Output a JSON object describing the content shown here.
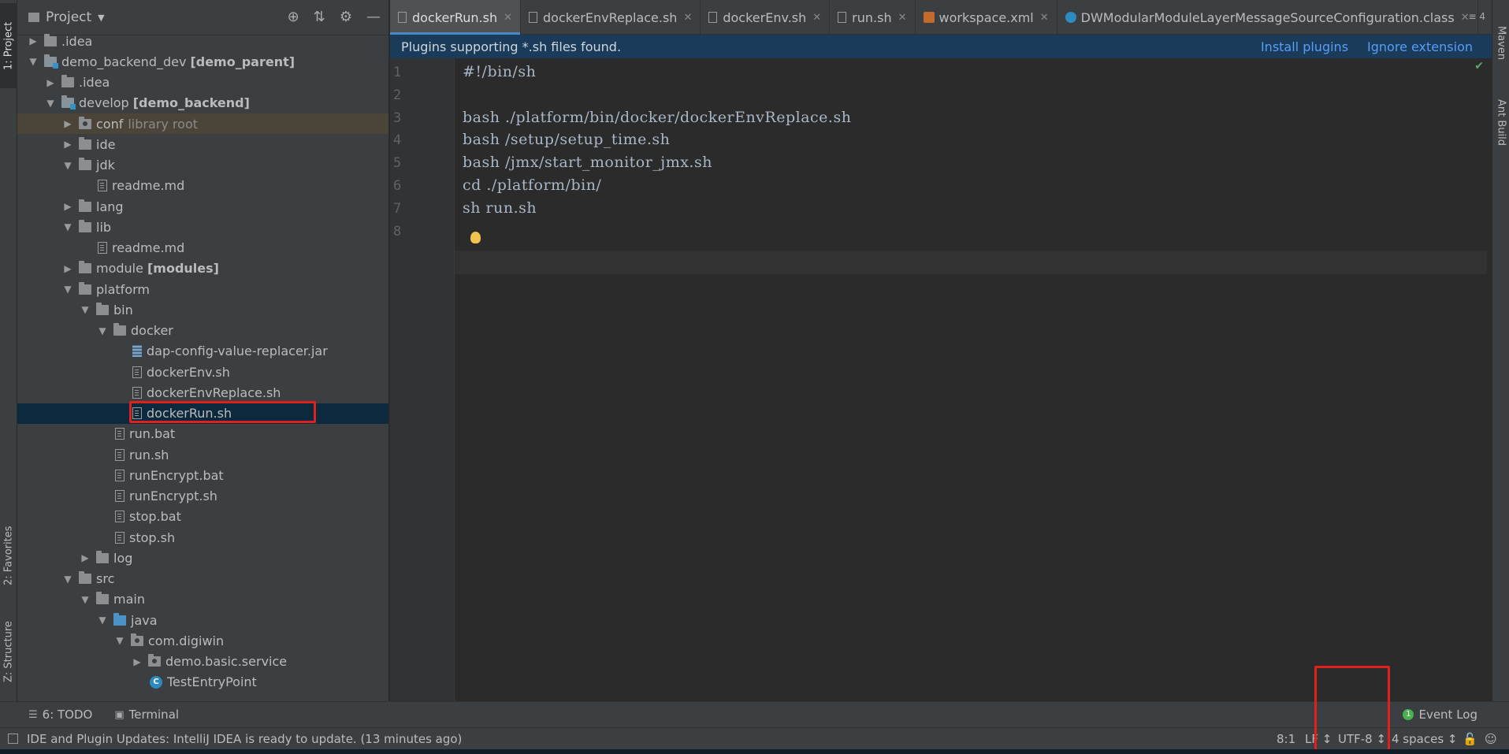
{
  "left_strip": {
    "project_tab": "1: Project",
    "favorites_tab": "2: Favorites",
    "structure_tab": "Z: Structure"
  },
  "right_strip": {
    "maven_tab": "Maven",
    "ant_tab": "Ant Build"
  },
  "project_panel": {
    "title": "Project",
    "tree": [
      {
        "indent": 0,
        "arrow": "right",
        "icon": "folder",
        "label": ".idea"
      },
      {
        "indent": 0,
        "arrow": "down",
        "icon": "module",
        "label": "demo_backend_dev",
        "bold": "[demo_parent]"
      },
      {
        "indent": 1,
        "arrow": "right",
        "icon": "folder",
        "label": ".idea"
      },
      {
        "indent": 1,
        "arrow": "down",
        "icon": "module",
        "label": "develop",
        "bold": "[demo_backend]"
      },
      {
        "indent": 2,
        "arrow": "right",
        "icon": "pkg",
        "label": "conf",
        "muted": "library root",
        "highlight": "conf"
      },
      {
        "indent": 2,
        "arrow": "right",
        "icon": "folder",
        "label": "ide"
      },
      {
        "indent": 2,
        "arrow": "down",
        "icon": "folder",
        "label": "jdk"
      },
      {
        "indent": 3,
        "arrow": "",
        "icon": "doc",
        "label": "readme.md"
      },
      {
        "indent": 2,
        "arrow": "right",
        "icon": "folder",
        "label": "lang"
      },
      {
        "indent": 2,
        "arrow": "down",
        "icon": "folder",
        "label": "lib"
      },
      {
        "indent": 3,
        "arrow": "",
        "icon": "doc",
        "label": "readme.md"
      },
      {
        "indent": 2,
        "arrow": "right",
        "icon": "folder",
        "label": "module",
        "bold": "[modules]"
      },
      {
        "indent": 2,
        "arrow": "down",
        "icon": "folder",
        "label": "platform"
      },
      {
        "indent": 3,
        "arrow": "down",
        "icon": "folder",
        "label": "bin"
      },
      {
        "indent": 4,
        "arrow": "down",
        "icon": "folder",
        "label": "docker"
      },
      {
        "indent": 5,
        "arrow": "",
        "icon": "jar",
        "label": "dap-config-value-replacer.jar"
      },
      {
        "indent": 5,
        "arrow": "",
        "icon": "doc",
        "label": "dockerEnv.sh"
      },
      {
        "indent": 5,
        "arrow": "",
        "icon": "doc",
        "label": "dockerEnvReplace.sh"
      },
      {
        "indent": 5,
        "arrow": "",
        "icon": "doc",
        "label": "dockerRun.sh",
        "highlight": "selected"
      },
      {
        "indent": 4,
        "arrow": "",
        "icon": "doc",
        "label": "run.bat"
      },
      {
        "indent": 4,
        "arrow": "",
        "icon": "doc",
        "label": "run.sh"
      },
      {
        "indent": 4,
        "arrow": "",
        "icon": "doc",
        "label": "runEncrypt.bat"
      },
      {
        "indent": 4,
        "arrow": "",
        "icon": "doc",
        "label": "runEncrypt.sh"
      },
      {
        "indent": 4,
        "arrow": "",
        "icon": "doc",
        "label": "stop.bat"
      },
      {
        "indent": 4,
        "arrow": "",
        "icon": "doc",
        "label": "stop.sh"
      },
      {
        "indent": 3,
        "arrow": "right",
        "icon": "folder",
        "label": "log"
      },
      {
        "indent": 2,
        "arrow": "down",
        "icon": "folder",
        "label": "src"
      },
      {
        "indent": 3,
        "arrow": "down",
        "icon": "folder",
        "label": "main"
      },
      {
        "indent": 4,
        "arrow": "down",
        "icon": "java",
        "label": "java"
      },
      {
        "indent": 5,
        "arrow": "down",
        "icon": "pkg",
        "label": "com.digiwin"
      },
      {
        "indent": 6,
        "arrow": "right",
        "icon": "pkg",
        "label": "demo.basic.service"
      },
      {
        "indent": 6,
        "arrow": "",
        "icon": "class",
        "label": "TestEntryPoint"
      }
    ]
  },
  "tabs": [
    {
      "label": "dockerRun.sh",
      "icon": "doc",
      "active": true
    },
    {
      "label": "dockerEnvReplace.sh",
      "icon": "doc"
    },
    {
      "label": "dockerEnv.sh",
      "icon": "doc"
    },
    {
      "label": "run.sh",
      "icon": "doc"
    },
    {
      "label": "workspace.xml",
      "icon": "xml"
    },
    {
      "label": "DWModularModuleLayerMessageSourceConfiguration.class",
      "icon": "class"
    }
  ],
  "tabs_more": "≡ 4",
  "banner": {
    "message": "Plugins supporting *.sh files found.",
    "install": "Install plugins",
    "ignore": "Ignore extension"
  },
  "editor": {
    "lines": [
      {
        "n": "1",
        "text": "#!/bin/sh"
      },
      {
        "n": "2",
        "text": ""
      },
      {
        "n": "3",
        "text": "bash ./platform/bin/docker/dockerEnvReplace.sh"
      },
      {
        "n": "4",
        "text": "bash /setup/setup_time.sh"
      },
      {
        "n": "5",
        "text": "bash /jmx/start_monitor_jmx.sh"
      },
      {
        "n": "6",
        "text": "cd ./platform/bin/"
      },
      {
        "n": "7",
        "text": "sh run.sh"
      },
      {
        "n": "8",
        "text": ""
      }
    ]
  },
  "bottom_tools": {
    "todo": "6: TODO",
    "terminal": "Terminal",
    "event_log": "Event Log",
    "event_count": "1"
  },
  "status": {
    "message": "IDE and Plugin Updates: IntelliJ IDEA is ready to update. (13 minutes ago)",
    "position": "8:1",
    "line_sep": "LF ↕",
    "encoding": "UTF-8 ↕",
    "indent": "4 spaces ↕"
  }
}
